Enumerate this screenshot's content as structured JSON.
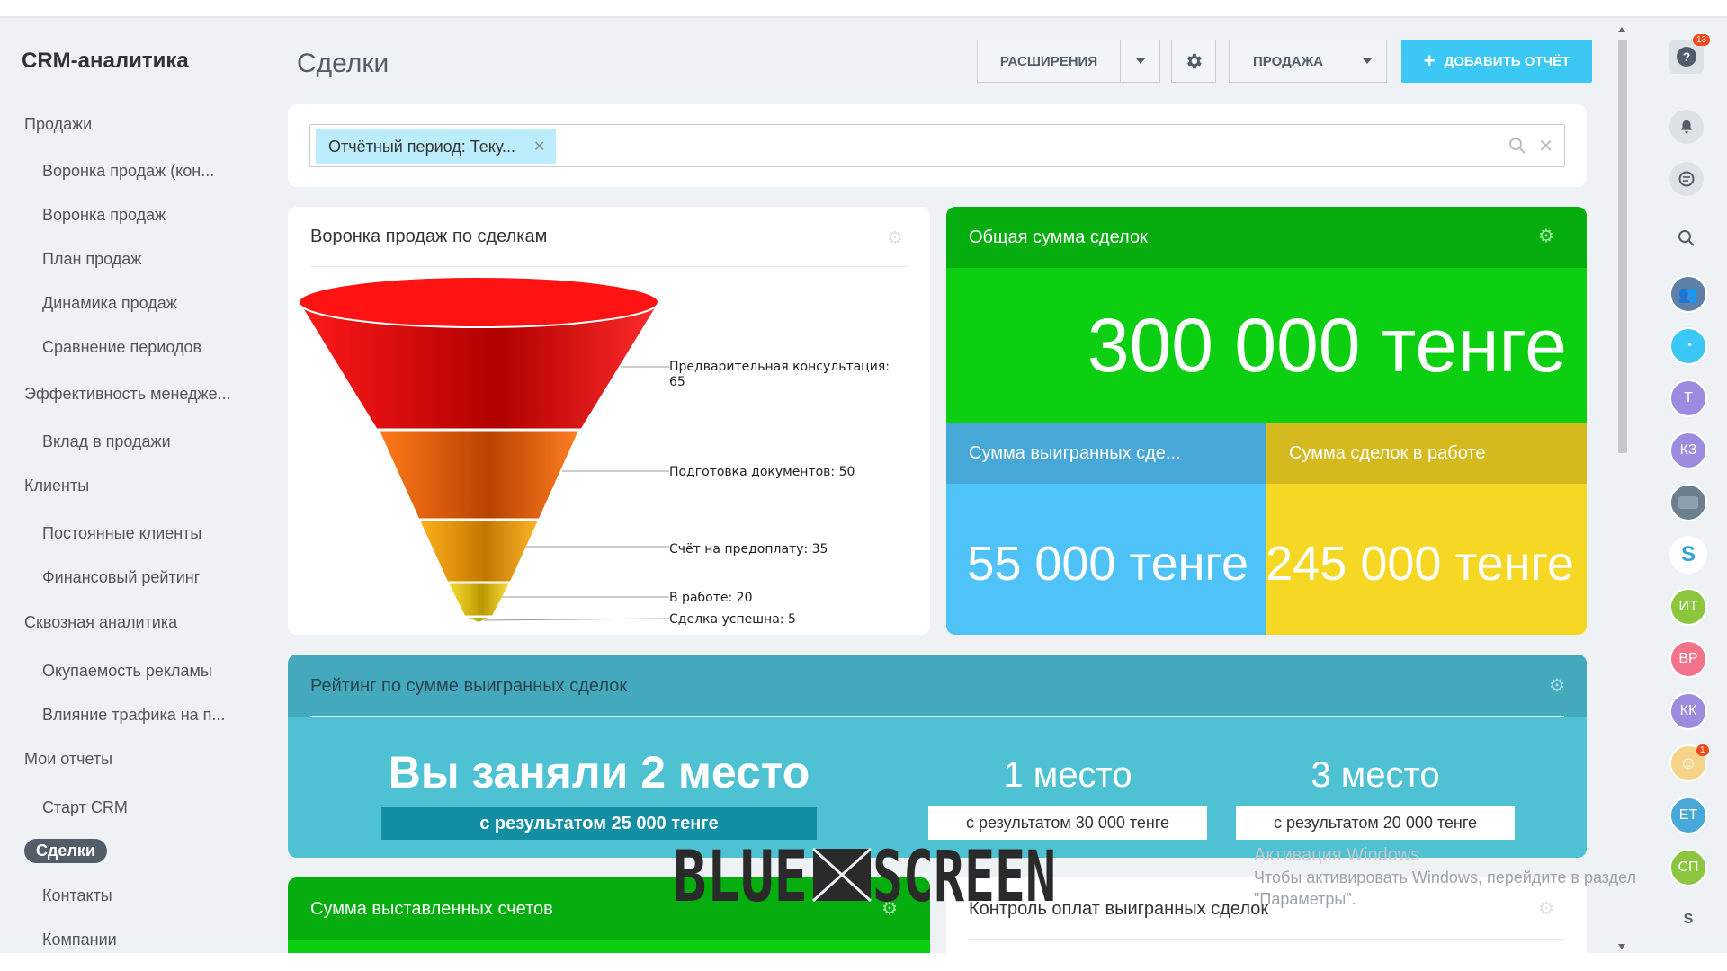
{
  "sidebar": {
    "app_title": "CRM-аналитика",
    "items": [
      {
        "label": "Продажи",
        "level": "top"
      },
      {
        "label": "Воронка продаж (кон...",
        "level": "sub"
      },
      {
        "label": "Воронка продаж",
        "level": "sub"
      },
      {
        "label": "План продаж",
        "level": "sub"
      },
      {
        "label": "Динамика продаж",
        "level": "sub"
      },
      {
        "label": "Сравнение периодов",
        "level": "sub"
      },
      {
        "label": "Эффективность менедже...",
        "level": "top"
      },
      {
        "label": "Вклад в продажи",
        "level": "sub"
      },
      {
        "label": "Клиенты",
        "level": "top"
      },
      {
        "label": "Постоянные клиенты",
        "level": "sub"
      },
      {
        "label": "Финансовый рейтинг",
        "level": "sub"
      },
      {
        "label": "Сквозная аналитика",
        "level": "top"
      },
      {
        "label": "Окупаемость рекламы",
        "level": "sub"
      },
      {
        "label": "Влияние трафика на п...",
        "level": "sub"
      },
      {
        "label": "Мои отчеты",
        "level": "top"
      },
      {
        "label": "Старт CRM",
        "level": "sub"
      },
      {
        "label": "Сделки",
        "level": "active"
      },
      {
        "label": "Контакты",
        "level": "sub"
      },
      {
        "label": "Компании",
        "level": "sub"
      }
    ]
  },
  "header": {
    "title": "Сделки",
    "extensions_label": "РАСШИРЕНИЯ",
    "sale_label": "ПРОДАЖА",
    "add_report_label": "ДОБАВИТЬ ОТЧЁТ"
  },
  "filter": {
    "chip_label": "Отчётный период: Теку..."
  },
  "funnel": {
    "title": "Воронка продаж по сделкам",
    "stages": [
      {
        "label": "Предварительная консультация:",
        "value": "65",
        "color": "#e00000"
      },
      {
        "label": "Подготовка документов: 50",
        "value": "",
        "color": "#e85d04"
      },
      {
        "label": "Счёт на предоплату: 35",
        "value": "",
        "color": "#e89a0c"
      },
      {
        "label": "В работе: 20",
        "value": "",
        "color": "#d9c21a"
      },
      {
        "label": "Сделка успешна: 5",
        "value": "",
        "color": "#c8c83a"
      }
    ]
  },
  "total": {
    "title": "Общая сумма сделок",
    "amount": "300 000 тенге",
    "head_color": "#06ad0e",
    "body_color": "#0ccf12"
  },
  "won": {
    "title": "Сумма выигранных сде...",
    "amount": "55 000 тенге",
    "head_color": "#47a8d8",
    "body_color": "#4fc3f7"
  },
  "inwork": {
    "title": "Сумма сделок в работе",
    "amount": "245 000 тенге",
    "head_color": "#d4ba1f",
    "body_color": "#f5d724"
  },
  "rating": {
    "title": "Рейтинг по сумме выигранных сделок",
    "main_place": "Вы заняли 2 место",
    "main_result": "с результатом 25 000 тенге",
    "first_place": "1 место",
    "first_result": "с результатом 30 000 тенге",
    "third_place": "3 место",
    "third_result": "с результатом 20 000 тенге"
  },
  "invoices": {
    "title": "Сумма выставленных счетов"
  },
  "payments": {
    "title": "Контроль оплат выигранных сделок"
  },
  "rightbar": {
    "help_badge": "13",
    "avatars": [
      {
        "initials": "Т",
        "color": "#9b8ce0"
      },
      {
        "initials": "КЗ",
        "color": "#9b8ce0"
      },
      {
        "initials": "ИТ",
        "color": "#8cc63f"
      },
      {
        "initials": "ВР",
        "color": "#f3738a"
      },
      {
        "initials": "КК",
        "color": "#9b8ce0"
      },
      {
        "initials": "ЕТ",
        "color": "#47a8d8"
      },
      {
        "initials": "СП",
        "color": "#8cc63f"
      }
    ],
    "cartoon_badge": "1"
  },
  "watermark": {
    "activate_title": "Активация Windows",
    "activate_text": "Чтобы активировать Windows, перейдите в раздел",
    "activate_text2": "\"Параметры\"."
  },
  "logo": {
    "text_left": "BLUE",
    "text_right": "SCREEN"
  }
}
